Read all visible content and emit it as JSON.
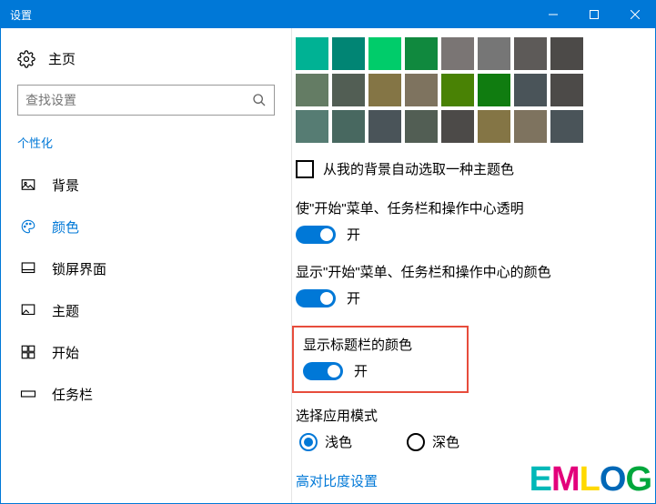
{
  "titlebar": {
    "title": "设置"
  },
  "sidebar": {
    "home": "主页",
    "search_placeholder": "查找设置",
    "section": "个性化",
    "items": [
      {
        "label": "背景"
      },
      {
        "label": "颜色"
      },
      {
        "label": "锁屏界面"
      },
      {
        "label": "主题"
      },
      {
        "label": "开始"
      },
      {
        "label": "任务栏"
      }
    ]
  },
  "swatch_colors": [
    "#00b294",
    "#018574",
    "#00cc6a",
    "#10893e",
    "#7a7574",
    "#767676",
    "#5d5a58",
    "#4c4a48",
    "#647c64",
    "#525e54",
    "#847545",
    "#7e735f",
    "#498205",
    "#107c10",
    "#4a5459",
    "#4c4a48",
    "#567c73",
    "#486860",
    "#4a5459",
    "#525e54",
    "#4c4a48",
    "#847545",
    "#7e735f",
    "#4a5459"
  ],
  "auto_color": {
    "label": "从我的背景自动选取一种主题色",
    "checked": false
  },
  "settings": {
    "transparency": {
      "label": "使\"开始\"菜单、任务栏和操作中心透明",
      "state": "开"
    },
    "accent_start": {
      "label": "显示\"开始\"菜单、任务栏和操作中心的颜色",
      "state": "开"
    },
    "title_color": {
      "label": "显示标题栏的颜色",
      "state": "开"
    }
  },
  "app_mode": {
    "label": "选择应用模式",
    "options": [
      {
        "label": "浅色",
        "checked": true
      },
      {
        "label": "深色",
        "checked": false
      }
    ]
  },
  "contrast_link": "高对比度设置",
  "watermark": "EMLOG"
}
